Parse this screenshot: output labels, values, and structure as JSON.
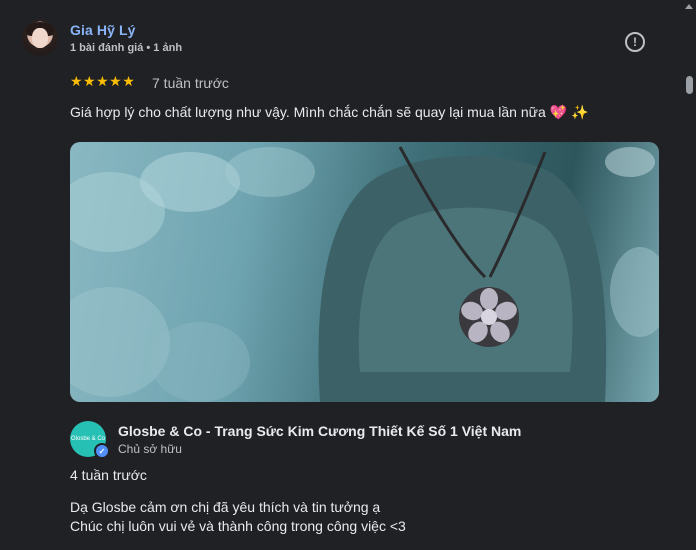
{
  "reviewer": {
    "name": "Gia Hỹ Lý",
    "meta": "1 bài đánh giá • 1 ảnh",
    "info_icon": "info-icon"
  },
  "review": {
    "rating": 5,
    "stars": "★★★★★",
    "time": "7 tuần trước",
    "text": "Giá hợp lý cho chất lượng như vậy. Mình chắc chắn sẽ quay lại mua lần nữa",
    "emoji_heart": "💖",
    "emoji_sparkle": "✨"
  },
  "owner": {
    "logo_text": "Glosbe & Co",
    "name": "Glosbe & Co - Trang Sức Kim Cương Thiết Kế Số 1 Việt Nam",
    "role": "Chủ sở hữu",
    "time": "4 tuần trước",
    "reply_line1": "Dạ Glosbe cảm ơn chị đã yêu thích và tin tưởng ạ",
    "reply_line2": "Chúc chị luôn vui vẻ và thành công trong công việc <3"
  },
  "colors": {
    "background": "#202124",
    "link": "#8ab4f8",
    "star": "#fbbc04",
    "owner_logo": "#27c0b5",
    "verified": "#4f8ff7"
  }
}
